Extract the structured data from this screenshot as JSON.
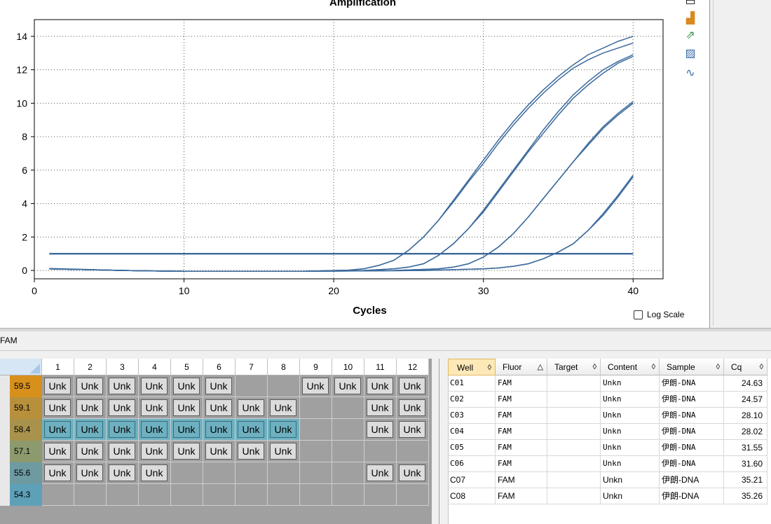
{
  "chart_data": {
    "type": "line",
    "title": "Amplification",
    "xlabel": "Cycles",
    "ylabel": "",
    "xlim": [
      0,
      42
    ],
    "ylim": [
      -0.5,
      15
    ],
    "xticks": [
      0,
      10,
      20,
      30,
      40
    ],
    "yticks": [
      0,
      2,
      4,
      6,
      8,
      10,
      12,
      14
    ],
    "grid": true,
    "log_scale": false,
    "threshold": 1.0,
    "line_color": "#3b6a9c",
    "series": [
      {
        "x": [
          1,
          6,
          10,
          18,
          21,
          22,
          23,
          24,
          25,
          26,
          27,
          28,
          29,
          30,
          31,
          32,
          33,
          34,
          35,
          36,
          37,
          38,
          39,
          40
        ],
        "y": [
          0.12,
          0.0,
          -0.05,
          -0.05,
          0.02,
          0.1,
          0.3,
          0.6,
          1.2,
          2.0,
          3.0,
          4.2,
          5.4,
          6.6,
          7.8,
          8.9,
          9.9,
          10.8,
          11.6,
          12.3,
          12.9,
          13.3,
          13.7,
          14.0
        ]
      },
      {
        "x": [
          1,
          6,
          10,
          18,
          21,
          22,
          23,
          24,
          25,
          26,
          27,
          28,
          29,
          30,
          31,
          32,
          33,
          34,
          35,
          36,
          37,
          38,
          39,
          40
        ],
        "y": [
          0.1,
          0.0,
          -0.05,
          -0.05,
          0.02,
          0.1,
          0.3,
          0.6,
          1.2,
          2.0,
          3.0,
          4.1,
          5.3,
          6.4,
          7.6,
          8.7,
          9.7,
          10.6,
          11.4,
          12.1,
          12.6,
          13.0,
          13.3,
          13.6
        ]
      },
      {
        "x": [
          1,
          6,
          10,
          18,
          22,
          24,
          25,
          26,
          27,
          28,
          29,
          30,
          31,
          32,
          33,
          34,
          35,
          36,
          37,
          38,
          39,
          40
        ],
        "y": [
          0.1,
          0.0,
          -0.05,
          -0.05,
          0.0,
          0.1,
          0.2,
          0.4,
          0.9,
          1.6,
          2.5,
          3.6,
          4.8,
          6.0,
          7.2,
          8.4,
          9.5,
          10.5,
          11.3,
          12.0,
          12.5,
          12.9
        ]
      },
      {
        "x": [
          1,
          6,
          10,
          18,
          22,
          24,
          25,
          26,
          27,
          28,
          29,
          30,
          31,
          32,
          33,
          34,
          35,
          36,
          37,
          38,
          39,
          40
        ],
        "y": [
          0.1,
          0.0,
          -0.05,
          -0.05,
          0.0,
          0.1,
          0.2,
          0.4,
          0.9,
          1.6,
          2.5,
          3.5,
          4.7,
          5.9,
          7.1,
          8.2,
          9.3,
          10.3,
          11.1,
          11.8,
          12.4,
          12.8
        ]
      },
      {
        "x": [
          1,
          6,
          10,
          18,
          24,
          27,
          28,
          29,
          30,
          31,
          32,
          33,
          34,
          35,
          36,
          37,
          38,
          39,
          40
        ],
        "y": [
          0.1,
          0.0,
          -0.05,
          -0.05,
          0.0,
          0.1,
          0.2,
          0.4,
          0.8,
          1.4,
          2.2,
          3.2,
          4.3,
          5.4,
          6.5,
          7.6,
          8.6,
          9.4,
          10.1
        ]
      },
      {
        "x": [
          1,
          6,
          10,
          18,
          24,
          27,
          28,
          29,
          30,
          31,
          32,
          33,
          34,
          35,
          36,
          37,
          38,
          39,
          40
        ],
        "y": [
          0.1,
          0.0,
          -0.05,
          -0.05,
          0.0,
          0.1,
          0.2,
          0.4,
          0.8,
          1.4,
          2.2,
          3.2,
          4.3,
          5.4,
          6.5,
          7.5,
          8.5,
          9.3,
          10.0
        ]
      },
      {
        "x": [
          1,
          6,
          10,
          18,
          26,
          30,
          31,
          32,
          33,
          34,
          35,
          36,
          37,
          38,
          39,
          40
        ],
        "y": [
          0.1,
          0.0,
          -0.05,
          -0.05,
          0.0,
          0.1,
          0.15,
          0.25,
          0.4,
          0.7,
          1.1,
          1.6,
          2.4,
          3.4,
          4.5,
          5.7
        ]
      },
      {
        "x": [
          1,
          6,
          10,
          18,
          26,
          30,
          31,
          32,
          33,
          34,
          35,
          36,
          37,
          38,
          39,
          40
        ],
        "y": [
          0.1,
          0.0,
          -0.05,
          -0.05,
          0.0,
          0.1,
          0.15,
          0.25,
          0.4,
          0.7,
          1.1,
          1.6,
          2.4,
          3.3,
          4.4,
          5.6
        ]
      }
    ]
  },
  "chart": {
    "log_scale_label": "Log Scale"
  },
  "filter_label": "FAM",
  "plate": {
    "columns": [
      "1",
      "2",
      "3",
      "4",
      "5",
      "6",
      "7",
      "8",
      "9",
      "10",
      "11",
      "12"
    ],
    "rows": [
      {
        "temp": "59.5",
        "color": "#d8901c",
        "cells": [
          "Unk",
          "Unk",
          "Unk",
          "Unk",
          "Unk",
          "Unk",
          "",
          "",
          "Unk",
          "Unk",
          "Unk",
          "Unk"
        ]
      },
      {
        "temp": "59.1",
        "color": "#b8903c",
        "cells": [
          "Unk",
          "Unk",
          "Unk",
          "Unk",
          "Unk",
          "Unk",
          "Unk",
          "Unk",
          "",
          "",
          "Unk",
          "Unk"
        ]
      },
      {
        "temp": "58.4",
        "color": "#a8924c",
        "cells": [
          "Unk",
          "Unk",
          "Unk",
          "Unk",
          "Unk",
          "Unk",
          "Unk",
          "Unk",
          "",
          "",
          "Unk",
          "Unk"
        ],
        "highlight": [
          0,
          1,
          2,
          3,
          4,
          5,
          6,
          7
        ]
      },
      {
        "temp": "57.1",
        "color": "#8c9a6e",
        "cells": [
          "Unk",
          "Unk",
          "Unk",
          "Unk",
          "Unk",
          "Unk",
          "Unk",
          "Unk",
          "",
          "",
          "",
          ""
        ]
      },
      {
        "temp": "55.6",
        "color": "#6e9aa2",
        "cells": [
          "Unk",
          "Unk",
          "Unk",
          "Unk",
          "",
          "",
          "",
          "",
          "",
          "",
          "Unk",
          "Unk"
        ]
      },
      {
        "temp": "54.3",
        "color": "#5ea0b8",
        "cells": [
          "",
          "",
          "",
          "",
          "",
          "",
          "",
          "",
          "",
          "",
          "",
          ""
        ]
      }
    ]
  },
  "table": {
    "headers": [
      {
        "label": "Well",
        "sort": "◊"
      },
      {
        "label": "Fluor",
        "sort": "△"
      },
      {
        "label": "Target",
        "sort": "◊"
      },
      {
        "label": "Content",
        "sort": "◊"
      },
      {
        "label": "Sample",
        "sort": "◊"
      },
      {
        "label": "Cq",
        "sort": "◊"
      }
    ],
    "rows": [
      [
        "C01",
        "FAM",
        "",
        "Unkn",
        "伊朗-DNA",
        "24.63"
      ],
      [
        "C02",
        "FAM",
        "",
        "Unkn",
        "伊朗-DNA",
        "24.57"
      ],
      [
        "C03",
        "FAM",
        "",
        "Unkn",
        "伊朗-DNA",
        "28.10"
      ],
      [
        "C04",
        "FAM",
        "",
        "Unkn",
        "伊朗-DNA",
        "28.02"
      ],
      [
        "C05",
        "FAM",
        "",
        "Unkn",
        "伊朗-DNA",
        "31.55"
      ],
      [
        "C06",
        "FAM",
        "",
        "Unkn",
        "伊朗-DNA",
        "31.60"
      ],
      [
        "C07",
        "FAM",
        "",
        "Unkn",
        "伊朗-DNA",
        "35.21"
      ],
      [
        "C08",
        "FAM",
        "",
        "Unkn",
        "伊朗-DNA",
        "35.26"
      ]
    ]
  }
}
